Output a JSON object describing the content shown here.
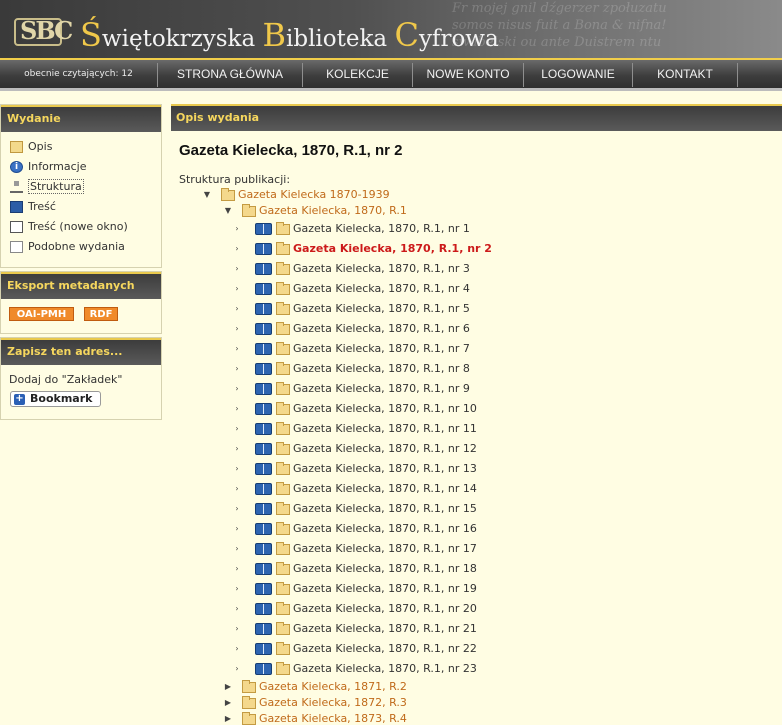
{
  "header": {
    "logo_text": "SBC",
    "title_parts": [
      {
        "cap": "Ś",
        "rest": "więtokrzyska "
      },
      {
        "cap": "B",
        "rest": "iblioteka "
      },
      {
        "cap": "C",
        "rest": "yfrowa"
      }
    ],
    "decor_script": [
      "Fr mojej gnil dźgerzer zpołuzatu",
      "somos nisus fuit a Bona & nifna!",
      "swabelski ou ante Duistrem ntu"
    ]
  },
  "nav": {
    "reading": "obecnie czytających: 12",
    "items": [
      "STRONA GŁÓWNA",
      "KOLEKCJE",
      "NOWE KONTO",
      "LOGOWANIE",
      "KONTAKT"
    ]
  },
  "sidebar": {
    "edition_title": "Wydanie",
    "edition_items": [
      {
        "label": "Opis",
        "icon": "page-icon"
      },
      {
        "label": "Informacje",
        "icon": "info-icon"
      },
      {
        "label": "Struktura",
        "icon": "tree-icon"
      },
      {
        "label": "Treść",
        "icon": "book-icon"
      },
      {
        "label": "Treść (nowe okno)",
        "icon": "new-window-icon"
      },
      {
        "label": "Podobne wydania",
        "icon": "similar-icon"
      }
    ],
    "export_title": "Eksport metadanych",
    "export_buttons": [
      "OAI-PMH",
      "RDF"
    ],
    "save_title": "Zapisz ten adres...",
    "save_text": "Dodaj do \"Zakładek\"",
    "bookmark_label": "Bookmark"
  },
  "main": {
    "header": "Opis wydania",
    "title": "Gazeta Kielecka, 1870, R.1, nr 2",
    "structure_label": "Struktura publikacji:",
    "root": "Gazeta Kielecka 1870-1939",
    "year_1870": "Gazeta Kielecka, 1870, R.1",
    "issues": [
      "Gazeta Kielecka, 1870, R.1, nr 1",
      "Gazeta Kielecka, 1870, R.1, nr 2",
      "Gazeta Kielecka, 1870, R.1, nr 3",
      "Gazeta Kielecka, 1870, R.1, nr 4",
      "Gazeta Kielecka, 1870, R.1, nr 5",
      "Gazeta Kielecka, 1870, R.1, nr 6",
      "Gazeta Kielecka, 1870, R.1, nr 7",
      "Gazeta Kielecka, 1870, R.1, nr 8",
      "Gazeta Kielecka, 1870, R.1, nr 9",
      "Gazeta Kielecka, 1870, R.1, nr 10",
      "Gazeta Kielecka, 1870, R.1, nr 11",
      "Gazeta Kielecka, 1870, R.1, nr 12",
      "Gazeta Kielecka, 1870, R.1, nr 13",
      "Gazeta Kielecka, 1870, R.1, nr 14",
      "Gazeta Kielecka, 1870, R.1, nr 15",
      "Gazeta Kielecka, 1870, R.1, nr 16",
      "Gazeta Kielecka, 1870, R.1, nr 17",
      "Gazeta Kielecka, 1870, R.1, nr 18",
      "Gazeta Kielecka, 1870, R.1, nr 19",
      "Gazeta Kielecka, 1870, R.1, nr 20",
      "Gazeta Kielecka, 1870, R.1, nr 21",
      "Gazeta Kielecka, 1870, R.1, nr 22",
      "Gazeta Kielecka, 1870, R.1, nr 23"
    ],
    "current_issue_index": 1,
    "other_years": [
      "Gazeta Kielecka, 1871, R.2",
      "Gazeta Kielecka, 1872, R.3",
      "Gazeta Kielecka, 1873, R.4"
    ]
  },
  "colors": {
    "accent": "#f6d75e",
    "current": "#cc1a1a",
    "collection_link": "#c06a1a",
    "background": "#fffde3"
  }
}
